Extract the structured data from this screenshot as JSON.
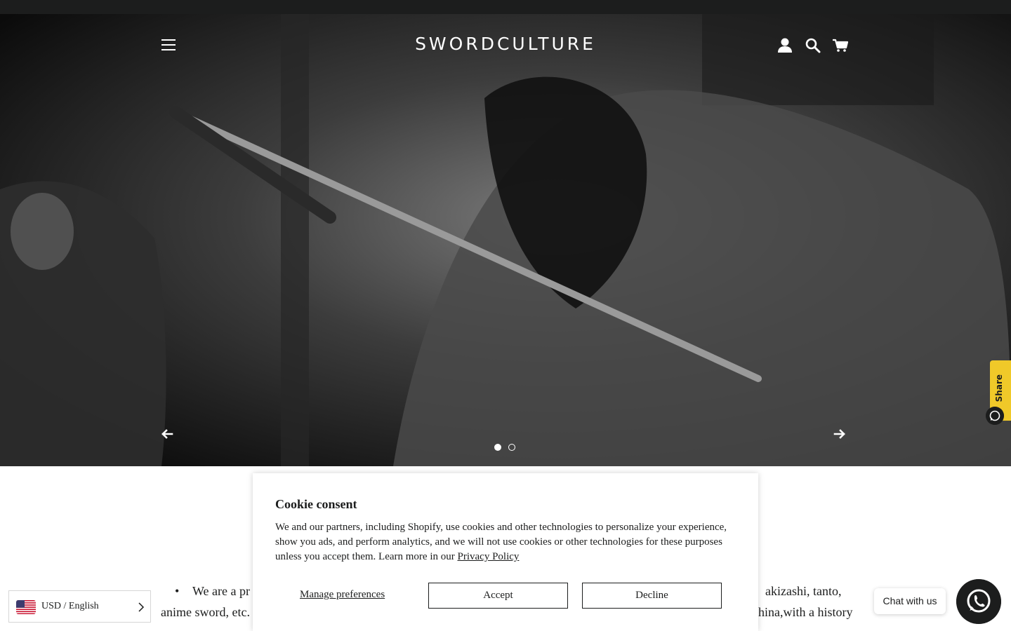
{
  "header": {
    "logo": "SWORDCULTURE",
    "icons": [
      "menu-icon",
      "account-icon",
      "search-icon",
      "cart-icon"
    ]
  },
  "hero": {
    "slides": 2,
    "active_slide": 1,
    "prev_icon": "arrow-left-icon",
    "next_icon": "arrow-right-icon"
  },
  "share": {
    "label": "Share",
    "icon": "whatsapp-icon",
    "color": "#f0c929"
  },
  "content": {
    "line1_start": "We are a pr",
    "line1_end": "akizashi, tanto,",
    "line2_start": "anime sword, etc.",
    "line2_end": "hina,with a history"
  },
  "cookie": {
    "title": "Cookie consent",
    "body": "We and our partners, including Shopify, use cookies and other technologies to personalize your experience, show you ads, and perform analytics, and we will not use cookies or other technologies for these purposes unless you accept them. Learn more in our",
    "link": "Privacy Policy",
    "manage_label": "Manage preferences",
    "accept_label": "Accept",
    "decline_label": "Decline"
  },
  "currency": {
    "label": "USD / English",
    "flag_icon": "us-flag-icon"
  },
  "chat": {
    "label": "Chat with us",
    "icon": "whatsapp-icon"
  },
  "colors": {
    "dark": "#1c1d1d",
    "share_yellow": "#f0c929",
    "white": "#ffffff"
  }
}
